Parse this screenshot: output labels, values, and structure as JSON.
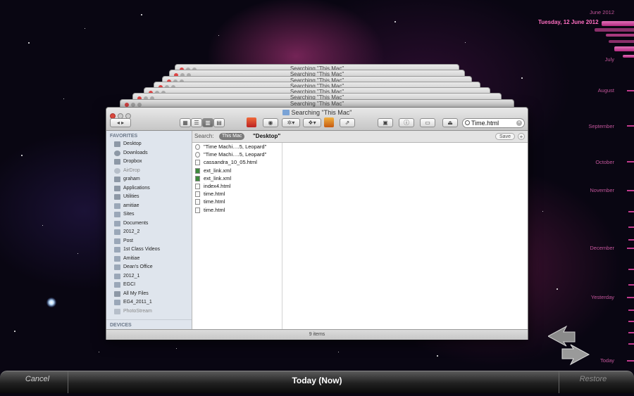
{
  "window": {
    "title": "Searching \"This Mac\"",
    "stacked_titles": [
      "Searching \"This Mac\"",
      "Searching \"This Mac\"",
      "Searching \"This Mac\"",
      "Searching \"This Mac\"",
      "Searching \"This Mac\"",
      "Searching \"This Mac\"",
      "Searching \"This Mac\""
    ],
    "search_value": "Time.html",
    "status": "9 items"
  },
  "searchbar": {
    "label": "Search:",
    "scope_active": "This Mac",
    "scope_other": "\"Desktop\"",
    "save_label": "Save",
    "plus_label": "+"
  },
  "sidebar": {
    "favorites_label": "FAVORITES",
    "devices_label": "DEVICES",
    "items": [
      {
        "label": "Desktop",
        "icon": "desktop-icon"
      },
      {
        "label": "Downloads",
        "icon": "downloads-icon"
      },
      {
        "label": "Dropbox",
        "icon": "dropbox-icon"
      },
      {
        "label": "AirDrop",
        "icon": "airdrop-icon"
      },
      {
        "label": "graham",
        "icon": "home-icon"
      },
      {
        "label": "Applications",
        "icon": "applications-icon"
      },
      {
        "label": "Utilities",
        "icon": "utilities-icon"
      },
      {
        "label": "amitiae",
        "icon": "folder-icon"
      },
      {
        "label": "Sites",
        "icon": "folder-icon"
      },
      {
        "label": "Documents",
        "icon": "folder-icon"
      },
      {
        "label": "2012_2",
        "icon": "folder-icon"
      },
      {
        "label": "Post",
        "icon": "folder-icon"
      },
      {
        "label": "1st Class Videos",
        "icon": "folder-icon"
      },
      {
        "label": "Amitiae",
        "icon": "folder-icon"
      },
      {
        "label": "Dean's Office",
        "icon": "folder-icon"
      },
      {
        "label": "2012_1",
        "icon": "folder-icon"
      },
      {
        "label": "EGCI",
        "icon": "folder-icon"
      },
      {
        "label": "All My Files",
        "icon": "all-files-icon"
      },
      {
        "label": "EG4_2011_1",
        "icon": "folder-icon"
      },
      {
        "label": "PhotoStream",
        "icon": "photostream-icon"
      }
    ]
  },
  "files": [
    "\"Time Machi….5, Leopard\"",
    "\"Time Machi….5, Leopard\"",
    "cassandra_10_05.html",
    "ext_link.xml",
    "ext_link.xml",
    "index4.html",
    "time.html",
    "time.html",
    "time.html"
  ],
  "timeline": {
    "current_date": "Tuesday, 12 June 2012",
    "labels": [
      "June 2012",
      "July",
      "August",
      "September",
      "October",
      "November",
      "December",
      "Yesterday",
      "Today"
    ]
  },
  "bottombar": {
    "cancel_label": "Cancel",
    "center_label": "Today (Now)",
    "restore_label": "Restore"
  },
  "colors": {
    "accent": "#c33b8e",
    "timeline_text": "#c2559a"
  }
}
